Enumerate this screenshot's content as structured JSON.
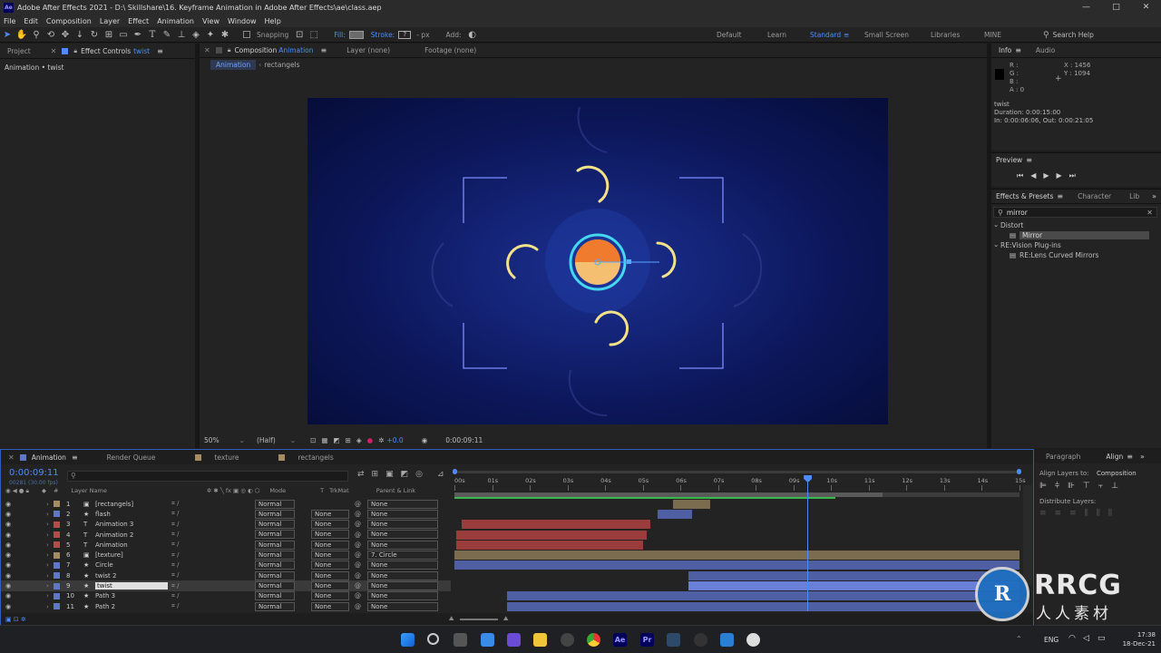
{
  "window": {
    "title": "Adobe After Effects 2021 - D:\\ Skillshare\\16. Keyframe Animation in Adobe After Effects\\ae\\class.aep",
    "app_logo": "Ae",
    "controls": [
      "—",
      "□",
      "✕"
    ]
  },
  "menu": [
    "File",
    "Edit",
    "Composition",
    "Layer",
    "Effect",
    "Animation",
    "View",
    "Window",
    "Help"
  ],
  "toolbar": {
    "snapping": "Snapping",
    "fill": "Fill:",
    "stroke": "Stroke:",
    "stroke_value": "?",
    "px": "- px",
    "add": "Add:"
  },
  "workspaces": {
    "items": [
      "Default",
      "Learn",
      "Standard",
      "Small Screen",
      "Libraries",
      "MINE"
    ],
    "active": "Standard",
    "search_placeholder": "Search Help"
  },
  "left_panel": {
    "tab_project": "Project",
    "tab_effect_controls": "Effect Controls",
    "effect_controls_target": "twist",
    "subtitle": "Animation • twist"
  },
  "comp_panel": {
    "tab_prefix": "Composition",
    "comp_name": "Animation",
    "layer_tab": "Layer (none)",
    "footage_tab": "Footage (none)",
    "breadcrumbs": [
      "Animation",
      "rectangels"
    ],
    "zoom": "50%",
    "resolution": "(Half)",
    "exposure": "+0.0",
    "timecode": "0:00:09:11"
  },
  "info_panel": {
    "tab_info": "Info",
    "tab_audio": "Audio",
    "r": "R :",
    "g": "G :",
    "b": "B :",
    "a": "A : 0",
    "x": "X : 1456",
    "y": "Y : 1094",
    "layer_name": "twist",
    "duration": "Duration: 0:00:15:00",
    "inout": "In: 0:00:06:06, Out: 0:00:21:05"
  },
  "preview_panel": {
    "title": "Preview"
  },
  "effects_panel": {
    "tab_effects": "Effects & Presets",
    "tab_character": "Character",
    "tab_lib": "Lib",
    "search_value": "mirror",
    "tree": [
      {
        "label": "Distort",
        "kind": "folder"
      },
      {
        "label": "Mirror",
        "kind": "effect",
        "selected": true
      },
      {
        "label": "RE:Vision Plug-ins",
        "kind": "folder"
      },
      {
        "label": "RE:Lens Curved Mirrors",
        "kind": "effect"
      }
    ]
  },
  "align_panel": {
    "tab_paragraph": "Paragraph",
    "tab_align": "Align",
    "align_to_label": "Align Layers to:",
    "align_to_value": "Composition",
    "distribute_label": "Distribute Layers:"
  },
  "timeline": {
    "tabs": [
      "Animation",
      "Render Queue",
      "texture",
      "rectangels"
    ],
    "tab_colors": [
      "#5f76c9",
      "",
      "#a48c63",
      "#a48c63"
    ],
    "timecode": "0:00:09:11",
    "fps": "00281 (30.00 fps)",
    "col_layer_name": "Layer Name",
    "col_mode": "Mode",
    "col_t": "T",
    "col_trkmat": "TrkMat",
    "col_parent": "Parent & Link",
    "col_num": "#",
    "ruler": [
      "00s",
      "01s",
      "02s",
      "03s",
      "04s",
      "05s",
      "06s",
      "07s",
      "08s",
      "09s",
      "10s",
      "11s",
      "12s",
      "13s",
      "14s",
      "15s"
    ],
    "current_time_s": 9.37,
    "layers": [
      {
        "num": "1",
        "type": "comp",
        "name": "[rectangels]",
        "color": "#a48c63",
        "mode": "Normal",
        "trkmat": "",
        "parent": "None",
        "bar_start_s": 5.8,
        "bar_end_s": 6.8,
        "bar_color": "#7b6b4f"
      },
      {
        "num": "2",
        "type": "star",
        "name": "flash",
        "color": "#5f76c9",
        "mode": "Normal",
        "trkmat": "None",
        "parent": "None",
        "bar_start_s": 5.4,
        "bar_end_s": 6.3,
        "bar_color": "#4f5fa3"
      },
      {
        "num": "3",
        "type": "text",
        "name": "Animation 3",
        "color": "#b74a4a",
        "mode": "Normal",
        "trkmat": "None",
        "parent": "None",
        "bar_start_s": 0.2,
        "bar_end_s": 5.2,
        "bar_color": "#9b3c3c"
      },
      {
        "num": "4",
        "type": "text",
        "name": "Animation 2",
        "color": "#b74a4a",
        "mode": "Normal",
        "trkmat": "None",
        "parent": "None",
        "bar_start_s": 0.05,
        "bar_end_s": 5.1,
        "bar_color": "#9b3c3c"
      },
      {
        "num": "5",
        "type": "text",
        "name": "Animation",
        "color": "#b74a4a",
        "mode": "Normal",
        "trkmat": "None",
        "parent": "None",
        "bar_start_s": 0.05,
        "bar_end_s": 5.0,
        "bar_color": "#9b3c3c"
      },
      {
        "num": "6",
        "type": "comp",
        "name": "[texture]",
        "color": "#a48c63",
        "mode": "Normal",
        "trkmat": "None",
        "parent": "7. Circle",
        "bar_start_s": 0.0,
        "bar_end_s": 15.0,
        "bar_color": "#7b6b4f"
      },
      {
        "num": "7",
        "type": "star",
        "name": "Circle",
        "color": "#5f76c9",
        "mode": "Normal",
        "trkmat": "None",
        "parent": "None",
        "bar_start_s": 0.0,
        "bar_end_s": 15.0,
        "bar_color": "#4f5fa3"
      },
      {
        "num": "8",
        "type": "star",
        "name": "twist 2",
        "color": "#5f76c9",
        "mode": "Normal",
        "trkmat": "None",
        "parent": "None",
        "bar_start_s": 6.2,
        "bar_end_s": 15.0,
        "bar_color": "#4f5fa3"
      },
      {
        "num": "9",
        "type": "star",
        "name": "twist",
        "color": "#5f76c9",
        "mode": "Normal",
        "trkmat": "None",
        "parent": "None",
        "selected": true,
        "bar_start_s": 6.2,
        "bar_end_s": 15.0,
        "bar_color": "#6a80d8"
      },
      {
        "num": "10",
        "type": "star",
        "name": "Path 3",
        "color": "#5f76c9",
        "mode": "Normal",
        "trkmat": "None",
        "parent": "None",
        "bar_start_s": 1.4,
        "bar_end_s": 15.0,
        "bar_color": "#4f5fa3"
      },
      {
        "num": "11",
        "type": "star",
        "name": "Path 2",
        "color": "#5f76c9",
        "mode": "Normal",
        "trkmat": "None",
        "parent": "None",
        "bar_start_s": 1.4,
        "bar_end_s": 15.0,
        "bar_color": "#4f5fa3"
      }
    ]
  },
  "watermark": {
    "text": "RRCG",
    "sub": "人人素材"
  },
  "taskbar": {
    "lang": "ENG",
    "time": "17:38",
    "date": "18-Dec-21"
  }
}
